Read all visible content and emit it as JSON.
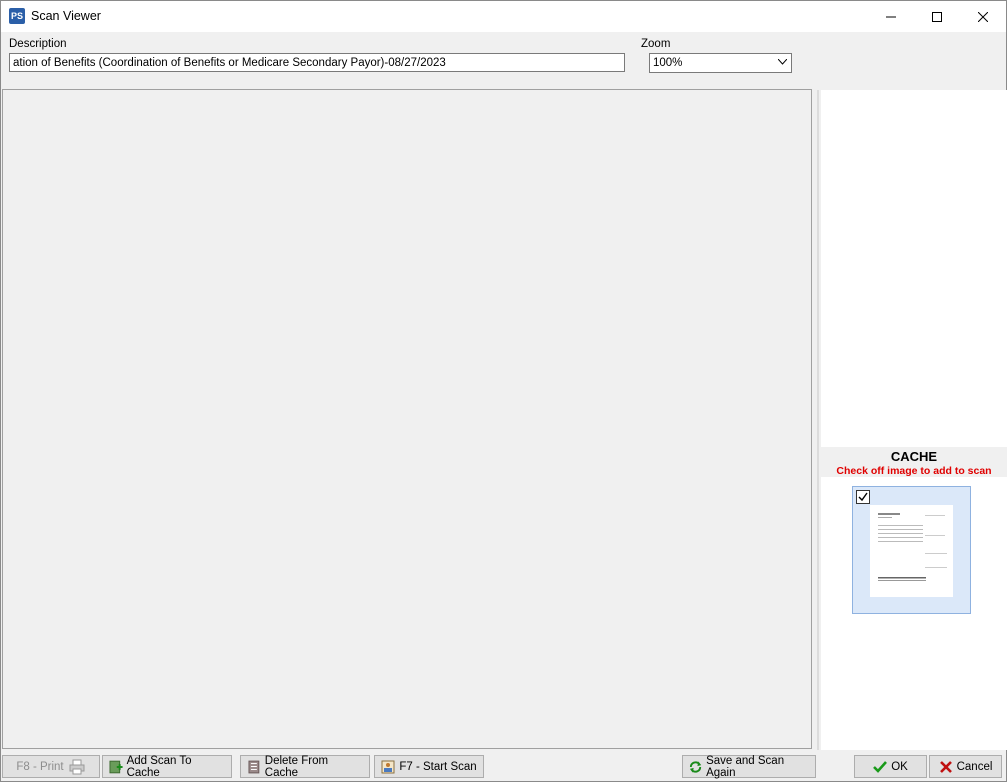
{
  "window": {
    "title": "Scan Viewer"
  },
  "fields": {
    "description_label": "Description",
    "description_value": "ation of Benefits (Coordination of Benefits or Medicare Secondary Payor)-08/27/2023",
    "zoom_label": "Zoom",
    "zoom_value": "100%"
  },
  "cache": {
    "title": "CACHE",
    "subtitle": "Check off image to add to scan",
    "items": [
      {
        "checked": true
      }
    ]
  },
  "buttons": {
    "print": "F8 - Print",
    "add_to_cache": "Add Scan To Cache",
    "delete_from_cache": "Delete From Cache",
    "start_scan": "F7 - Start Scan",
    "save_and_scan_again": "Save and Scan Again",
    "ok": "OK",
    "cancel": "Cancel"
  },
  "colors": {
    "accent_red": "#e00000",
    "thumb_bg": "#dbe8f9"
  },
  "icons": {
    "print": "printer-icon",
    "add": "add-scan-icon",
    "delete": "delete-icon",
    "scan": "scanner-icon",
    "save": "save-rescan-icon",
    "ok": "checkmark-icon",
    "cancel": "x-icon"
  }
}
